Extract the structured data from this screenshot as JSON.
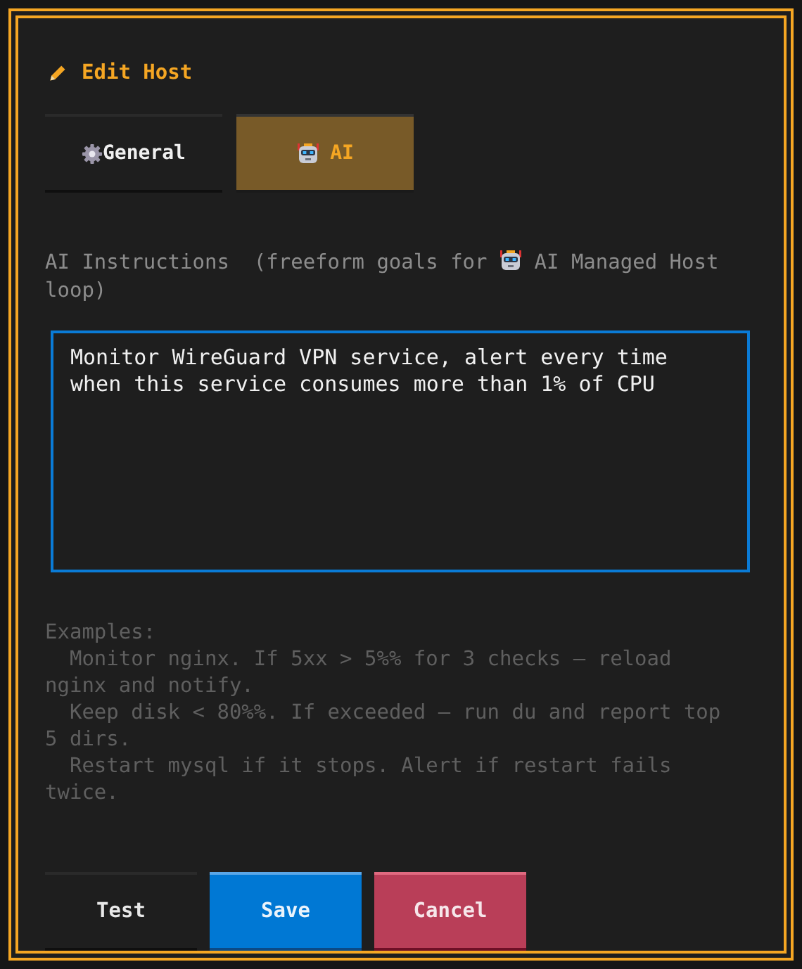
{
  "dialog": {
    "title": "Edit Host"
  },
  "tabs": [
    {
      "label": "General",
      "selected": false
    },
    {
      "label": "AI",
      "selected": true
    }
  ],
  "instructions": {
    "label_start": "AI Instructions  (freeform goals for",
    "label_end": "AI Managed Host",
    "label_wrap": "loop)",
    "value": "Monitor WireGuard VPN service, alert every time when this service consumes more than 1% of CPU"
  },
  "examples": "Examples:\n  Monitor nginx. If 5xx > 5%% for 3 checks – reload nginx and notify.\n  Keep disk < 80%%. If exceeded – run du and report top 5 dirs.\n  Restart mysql if it stops. Alert if restart fails twice.",
  "buttons": [
    {
      "label": "Test",
      "kind": "plain"
    },
    {
      "label": "Save",
      "kind": "primary"
    },
    {
      "label": "Cancel",
      "kind": "danger"
    }
  ]
}
